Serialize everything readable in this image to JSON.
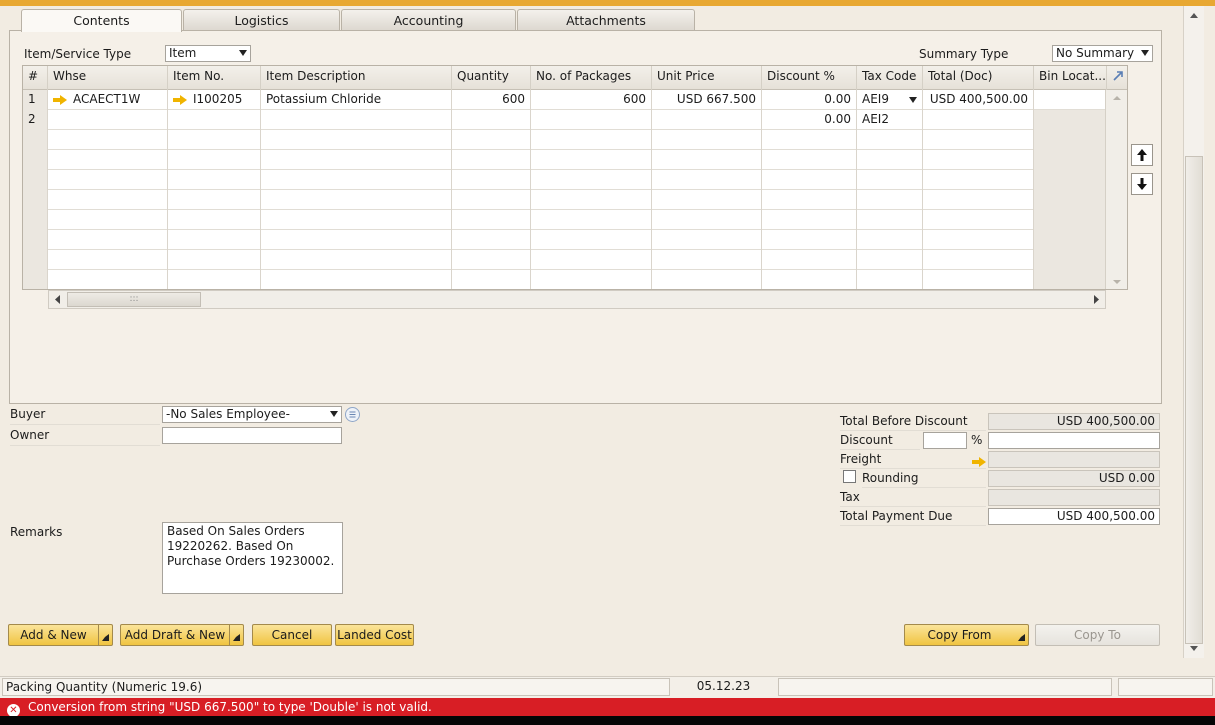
{
  "tabs": [
    "Contents",
    "Logistics",
    "Accounting",
    "Attachments"
  ],
  "header": {
    "item_service_type_label": "Item/Service Type",
    "item_service_type_value": "Item",
    "summary_type_label": "Summary Type",
    "summary_type_value": "No Summary"
  },
  "grid": {
    "columns": [
      "#",
      "Whse",
      "Item No.",
      "Item Description",
      "Quantity",
      "No. of Packages",
      "Unit Price",
      "Discount %",
      "Tax Code",
      "Total (Doc)",
      "Bin Locat..."
    ],
    "rows": [
      {
        "num": "1",
        "whse": "ACAECT1W",
        "item_no": "I100205",
        "desc": "Potassium Chloride",
        "qty": "600",
        "packages": "600",
        "unit_price": "USD 667.500",
        "discount": "0.00",
        "tax_code": "AEI9",
        "total": "USD 400,500.00",
        "bin": ""
      },
      {
        "num": "2",
        "whse": "",
        "item_no": "",
        "desc": "",
        "qty": "",
        "packages": "",
        "unit_price": "",
        "discount": "0.00",
        "tax_code": "AEI2",
        "total": "",
        "bin": ""
      }
    ],
    "scroll_grip": ":::"
  },
  "left_fields": {
    "buyer_label": "Buyer",
    "buyer_value": "-No Sales Employee-",
    "owner_label": "Owner",
    "owner_value": "",
    "remarks_label": "Remarks",
    "remarks_value": "Based On Sales Orders 19220262. Based On Purchase Orders 19230002."
  },
  "totals": {
    "total_before_discount_label": "Total Before Discount",
    "total_before_discount_value": "USD 400,500.00",
    "discount_label": "Discount",
    "discount_percent": "",
    "percent_sign": "%",
    "discount_value": "",
    "freight_label": "Freight",
    "freight_value": "",
    "rounding_label": "Rounding",
    "rounding_value": "USD 0.00",
    "tax_label": "Tax",
    "tax_value": "",
    "total_payment_due_label": "Total Payment Due",
    "total_payment_due_value": "USD 400,500.00"
  },
  "buttons": {
    "add_new": "Add & New",
    "add_draft_new": "Add Draft & New",
    "cancel": "Cancel",
    "landed_cost": "Landed Cost",
    "copy_from": "Copy From",
    "copy_to": "Copy To"
  },
  "status": {
    "field_info": "Packing Quantity (Numeric 19.6)",
    "date": "05.12.23",
    "error": "Conversion from string \"USD 667.500\" to type 'Double' is not valid."
  },
  "colors": {
    "accent": "#f0c441",
    "error_bar": "#d81e25",
    "link_arrow": "#f0b400"
  }
}
